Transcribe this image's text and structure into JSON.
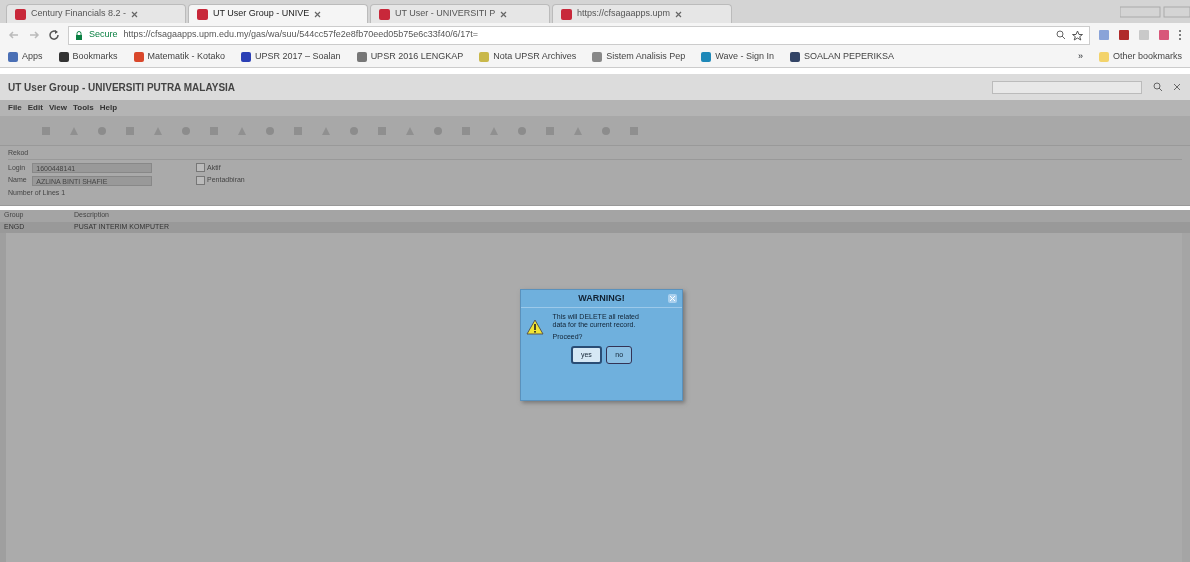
{
  "browser": {
    "tabs": [
      {
        "label": "Century Financials 8.2 - ",
        "selected": false
      },
      {
        "label": "UT User Group - UNIVE",
        "selected": true
      },
      {
        "label": "UT User - UNIVERSITI P",
        "selected": false
      },
      {
        "label": "https://cfsagaapps.upm",
        "selected": false
      }
    ],
    "secure_label": "Secure",
    "url": "https://cfsagaapps.upm.edu.my/gas/wa/suu/544cc57fe2e8fb70eed05b75e6c33f40/6/17t=",
    "bookmarks": [
      {
        "label": "Apps",
        "color": "#4a6fb5"
      },
      {
        "label": "Bookmarks",
        "color": "#333333"
      },
      {
        "label": "Matematik - Kotako",
        "color": "#d9472b"
      },
      {
        "label": "UPSR 2017 – Soalan",
        "color": "#2a3fb5"
      },
      {
        "label": "UPSR 2016 LENGKAP",
        "color": "#777777"
      },
      {
        "label": "Nota UPSR Archives",
        "color": "#c9b84a"
      },
      {
        "label": "Sistem Analisis Pep",
        "color": "#888888"
      },
      {
        "label": "Wave - Sign In",
        "color": "#1e88b8"
      },
      {
        "label": "SOALAN PEPERIKSA",
        "color": "#334466"
      }
    ],
    "more_bookmarks": "»",
    "other_bookmarks": "Other bookmarks"
  },
  "app": {
    "title": "UT User Group - UNIVERSITI PUTRA MALAYSIA",
    "menu": [
      "File",
      "Edit",
      "View",
      "Tools",
      "Help"
    ],
    "record": {
      "legend": "Rekod",
      "login_label": "Login",
      "login_value": "1600448141",
      "name_label": "Name",
      "name_value": "AZLINA BINTI SHAFIE",
      "lines": "Number of Lines 1",
      "checks": [
        {
          "label": "Aktif",
          "checked": false
        },
        {
          "label": "Pentadbiran",
          "checked": false
        }
      ]
    },
    "table": {
      "columns": [
        "Group",
        "Description"
      ],
      "rows": [
        {
          "cells": [
            "ENGD",
            "PUSAT INTERIM KOMPUTER"
          ],
          "selected": true
        }
      ]
    }
  },
  "dialog": {
    "title": "WARNING!",
    "message": "This will DELETE all related data for the current record.",
    "question": "Proceed?",
    "buttons": [
      {
        "label": "yes",
        "selected": true
      },
      {
        "label": "no",
        "selected": false
      }
    ]
  }
}
